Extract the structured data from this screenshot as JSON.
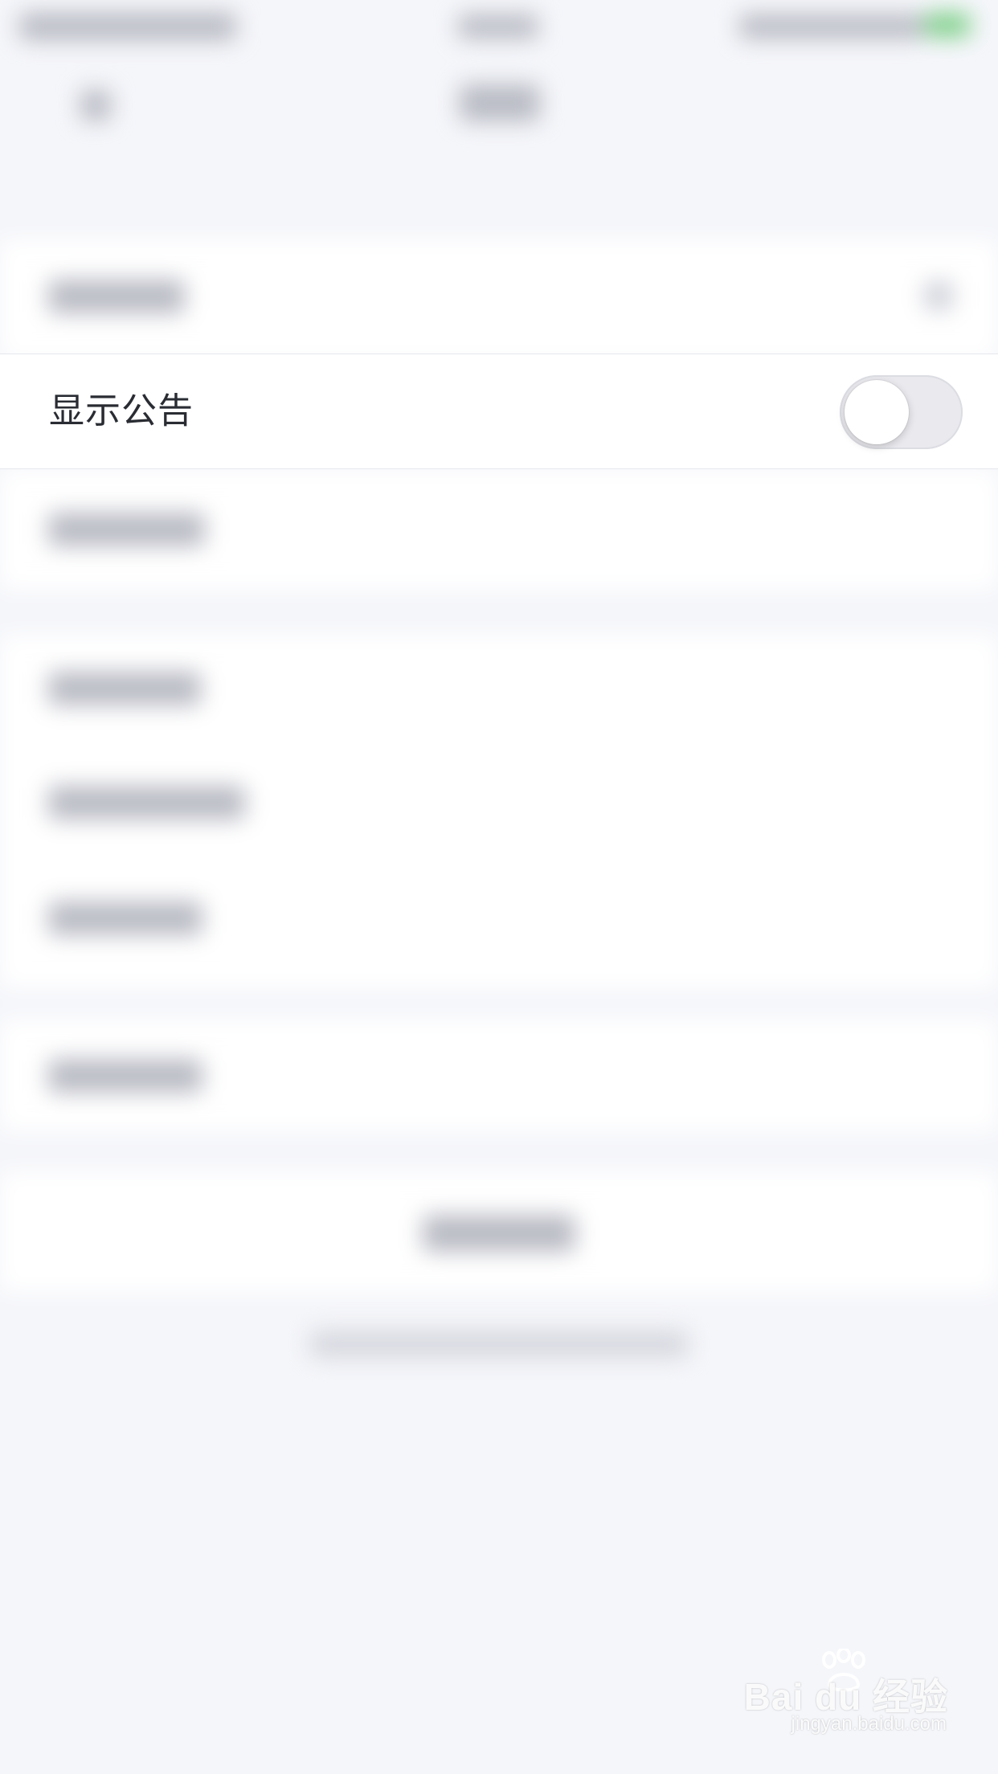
{
  "settings": {
    "focused_row": {
      "label": "显示公告",
      "toggle_on": false
    }
  },
  "watermark": {
    "brand": "Bai du 经验",
    "url": "jingyan.baidu.com"
  }
}
